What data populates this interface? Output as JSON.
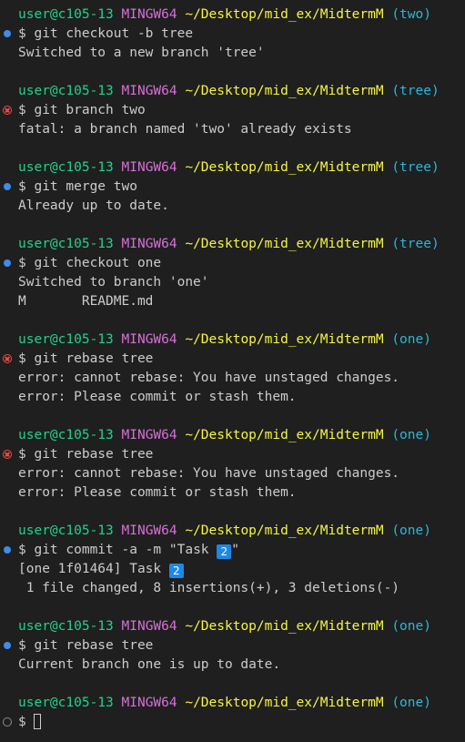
{
  "prompt": {
    "user": "user@c105-13",
    "system": "MINGW64",
    "path": "~/Desktop/mid_ex/MidtermM",
    "dollar": "$"
  },
  "blocks": [
    {
      "branch": "(two)",
      "status": "success",
      "command": "git checkout -b tree",
      "output": [
        "Switched to a new branch 'tree'"
      ]
    },
    {
      "branch": "(tree)",
      "status": "fail",
      "command": "git branch two",
      "output": [
        "fatal: a branch named 'two' already exists"
      ]
    },
    {
      "branch": "(tree)",
      "status": "success",
      "command": "git merge two",
      "output": [
        "Already up to date."
      ]
    },
    {
      "branch": "(tree)",
      "status": "success",
      "command": "git checkout one",
      "output": [
        "Switched to branch 'one'",
        "M       README.md"
      ]
    },
    {
      "branch": "(one)",
      "status": "fail",
      "command": "git rebase tree",
      "output": [
        "error: cannot rebase: You have unstaged changes.",
        "error: Please commit or stash them."
      ]
    },
    {
      "branch": "(one)",
      "status": "fail",
      "command": "git rebase tree",
      "output": [
        "error: cannot rebase: You have unstaged changes.",
        "error: Please commit or stash them."
      ]
    },
    {
      "branch": "(one)",
      "status": "success",
      "command": "git commit -a -m \"Task ",
      "command_emoji": "2",
      "command_suffix": "\"",
      "output": [
        "[one 1f01464] Task ",
        " 1 file changed, 8 insertions(+), 3 deletions(-)"
      ],
      "output_emoji_line": 0
    },
    {
      "branch": "(one)",
      "status": "success",
      "command": "git rebase tree",
      "output": [
        "Current branch one is up to date."
      ]
    },
    {
      "branch": "(one)",
      "status": "empty",
      "command": "",
      "output": [],
      "cursor": true
    }
  ],
  "emoji_label": "2",
  "colors": {
    "user": "#23d18b",
    "system": "#d670d6",
    "path": "#f5f543",
    "branch": "#29b8db",
    "success_dot": "#3b8eea",
    "fail_icon": "#f14c4c",
    "background": "#1f1f1f"
  }
}
